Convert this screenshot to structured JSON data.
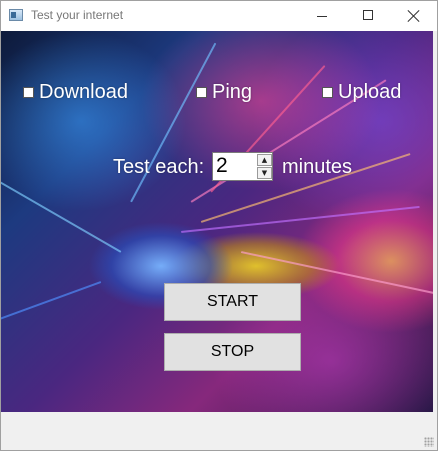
{
  "window": {
    "title": "Test your internet"
  },
  "checkboxes": [
    {
      "label": "Download",
      "checked": false
    },
    {
      "label": "Ping",
      "checked": false
    },
    {
      "label": "Upload",
      "checked": false
    }
  ],
  "interval": {
    "prefix": "Test each:",
    "value": "2",
    "suffix": "minutes"
  },
  "buttons": {
    "start_label": "START",
    "stop_label": "STOP"
  },
  "icons": {
    "spin_up": "▲",
    "spin_down": "▼"
  },
  "colors": {
    "button_face": "#e1e1e1",
    "label_text": "#ffffff",
    "window_bg": "#f0f0f0"
  }
}
